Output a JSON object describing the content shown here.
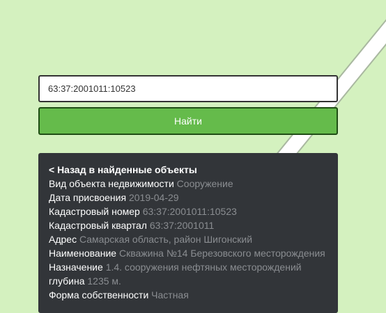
{
  "search": {
    "value": "63:37:2001011:10523",
    "button_label": "Найти"
  },
  "panel": {
    "back_link": "< Назад в найденные объекты",
    "rows": [
      {
        "label": "Вид объекта недвижимости",
        "value": "Сооружение"
      },
      {
        "label": "Дата присвоения",
        "value": "2019-04-29"
      },
      {
        "label": "Кадастровый номер",
        "value": "63:37:2001011:10523"
      },
      {
        "label": "Кадастровый квартал",
        "value": "63:37:2001011"
      },
      {
        "label": "Адрес",
        "value": "Самарская область, район Шигонский"
      },
      {
        "label": "Наименование",
        "value": "Скважина №14 Березовского месторождения"
      },
      {
        "label": "Назначение",
        "value": "1.4. сооружения нефтяных месторождений"
      },
      {
        "label": "глубина",
        "value": "1235 м."
      },
      {
        "label": "Форма собственности",
        "value": "Частная"
      }
    ]
  },
  "colors": {
    "map_background": "#d4f1bf",
    "button": "#65bb4b",
    "panel": "#323539",
    "value_text": "#8a8d91"
  }
}
